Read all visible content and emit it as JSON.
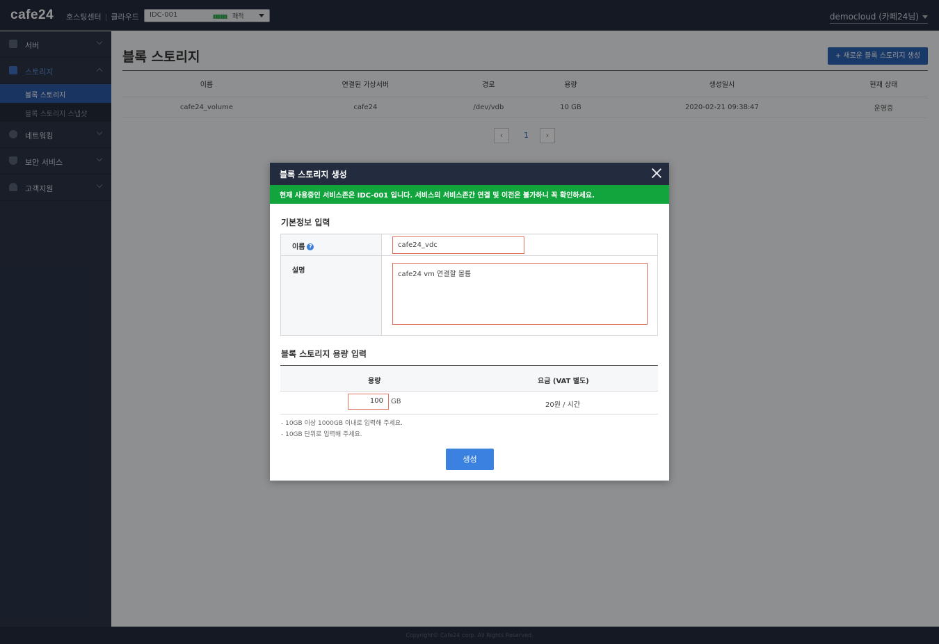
{
  "header": {
    "logo": "cafe24",
    "logo_sub1": "호스팅센터",
    "logo_sub2": "클라우드",
    "zone": "IDC-001",
    "zone_status_bars": "▮▮▮▮▮▮",
    "zone_status": "쾌적",
    "user": "democloud (카페24님)"
  },
  "sidebar": {
    "items": [
      {
        "label": "서버",
        "icon": "server-icon"
      },
      {
        "label": "스토리지",
        "icon": "storage-icon",
        "open": true
      },
      {
        "label": "네트워킹",
        "icon": "globe-icon"
      },
      {
        "label": "보안 서비스",
        "icon": "shield-icon"
      },
      {
        "label": "고객지원",
        "icon": "person-icon"
      }
    ],
    "subitems": [
      {
        "label": "블록 스토리지",
        "active": true
      },
      {
        "label": "블록 스토리지 스냅샷"
      }
    ]
  },
  "main": {
    "title": "블록 스토리지",
    "new_button": "+ 새로운 블록 스토리지 생성",
    "table": {
      "headers": [
        "이름",
        "연결된 가상서버",
        "경로",
        "용량",
        "생성일시",
        "현재 상태"
      ],
      "rows": [
        [
          "cafe24_volume",
          "cafe24",
          "/dev/vdb",
          "10 GB",
          "2020-02-21 09:38:47",
          "운영중"
        ]
      ]
    },
    "pagination": {
      "prev": "‹",
      "page": "1",
      "next": "›"
    }
  },
  "modal": {
    "title": "블록 스토리지 생성",
    "notice": "현재 사용중인 서비스존은 IDC-001 입니다. 서비스의 서비스존간 연결 및 이전은 불가하니 꼭 확인하세요.",
    "basic_section": "기본정보 입력",
    "name_label": "이름",
    "help_glyph": "?",
    "name_value": "cafe24_vdc",
    "desc_label": "설명",
    "desc_value": "cafe24 vm 연결할 볼륨",
    "capacity_section": "블록 스토리지 용량 입력",
    "capacity_header": "용량",
    "price_header": "요금 (VAT 별도)",
    "capacity_value": "100",
    "capacity_unit": "GB",
    "price_value": "20원 / 시간",
    "notes": [
      "- 10GB 이상 1000GB 이내로 입력해 주세요.",
      "- 10GB 단위로 입력해 주세요."
    ],
    "create_button": "생성"
  },
  "footer": {
    "copyright": "Copyright© Cafe24 corp. All Rights Reserved."
  },
  "colors": {
    "topbar": "#232b3e",
    "sidebar": "#2b3548",
    "accent": "#2c62b6",
    "notice": "#12a53d",
    "input_border": "#e07262",
    "create_button": "#3b82e0"
  }
}
